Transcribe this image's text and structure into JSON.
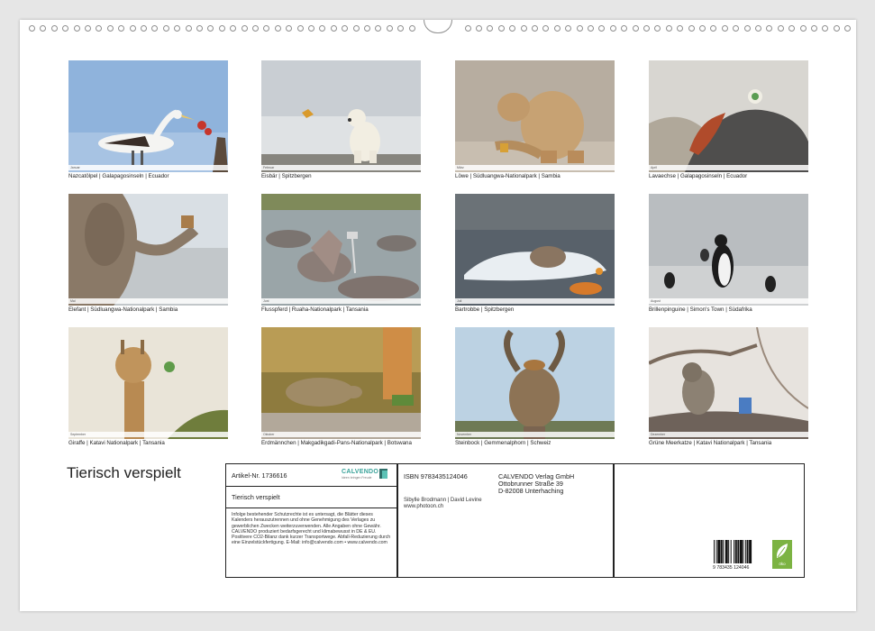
{
  "calendar_title": "Tierisch verspielt",
  "photos": [
    {
      "caption": "Nazcatölpel | Galapagosinseln | Ecuador",
      "month": "Januar"
    },
    {
      "caption": "Eisbär | Spitzbergen",
      "month": "Februar"
    },
    {
      "caption": "Löwe | Südluangwa-Nationalpark | Sambia",
      "month": "März"
    },
    {
      "caption": "Lavaechse | Galapagosinseln | Ecuador",
      "month": "April"
    },
    {
      "caption": "Elefant | Südluangwa-Nationalpark | Sambia",
      "month": "Mai"
    },
    {
      "caption": "Flusspferd | Ruaha-Nationalpark | Tansania",
      "month": "Juni"
    },
    {
      "caption": "Bartrobbe | Spitzbergen",
      "month": "Juli"
    },
    {
      "caption": "Brillenpinguine | Simon's Town | Südafrika",
      "month": "August"
    },
    {
      "caption": "Giraffe | Katavi Nationalpark | Tansania",
      "month": "September"
    },
    {
      "caption": "Erdmännchen | Makgadikgadi-Pans-Nationalpark | Botswana",
      "month": "Oktober"
    },
    {
      "caption": "Steinbock | Gemmenalphorn | Schweiz",
      "month": "November"
    },
    {
      "caption": "Grüne Meerkatze | Katavi Nationalpark | Tansania",
      "month": "Dezember"
    }
  ],
  "info": {
    "article": "Artikel-Nr. 1736616",
    "brand": "CALVENDO",
    "brand_tagline": "Ideen bringen Freude",
    "title": "Tierisch verspielt",
    "legal": "Infolge bestehender Schutzrechte ist es untersagt, die Blätter dieses Kalenders herauszutrennen und ohne Genehmigung des Verlages zu gewerblichen Zwecken weiterzuverwenden. Alle Angaben ohne Gewähr. CALVENDO produziert bedarfsgerecht und klimabewusst in DE & EU. Positivere CO2-Bilanz dank kurzer Transportwege. Abfall-Reduzierung durch eine Einzelstückfertigung. E-Mail: info@calvendo.com • www.calvendo.com",
    "isbn": "ISBN 9783435124046",
    "publisher_name": "CALVENDO Verlag GmbH",
    "publisher_street": "Ottobrunner Straße 39",
    "publisher_city": "D-82008 Unterhaching",
    "authors": "Sibylle Brodmann | David Levine",
    "website": "www.photoon.ch",
    "barcode_number": "9  783435  124046",
    "eco_label": "öko"
  },
  "colors": {
    "border": "#222222",
    "eco_green": "#7cb342",
    "brand_teal": "#3aa39a"
  }
}
